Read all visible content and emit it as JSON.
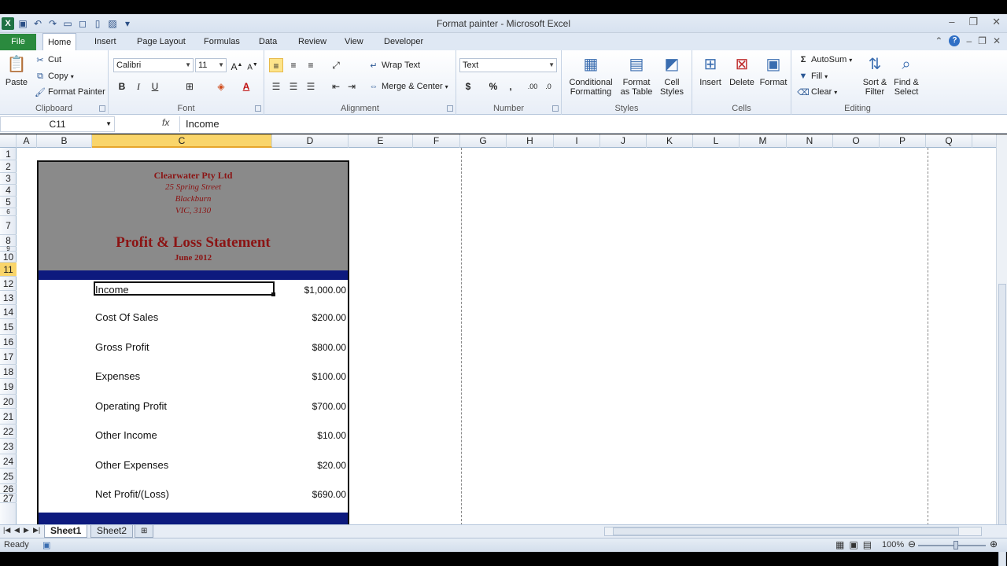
{
  "window": {
    "title": "Format painter  -  Microsoft Excel"
  },
  "tabs": {
    "file": "File",
    "items": [
      "Home",
      "Insert",
      "Page Layout",
      "Formulas",
      "Data",
      "Review",
      "View",
      "Developer"
    ]
  },
  "ribbon": {
    "clipboard": {
      "paste": "Paste",
      "cut": "Cut",
      "copy": "Copy",
      "format_painter": "Format Painter",
      "label": "Clipboard"
    },
    "font": {
      "name": "Calibri",
      "size": "11",
      "label": "Font"
    },
    "alignment": {
      "wrap": "Wrap Text",
      "merge": "Merge & Center",
      "label": "Alignment"
    },
    "number": {
      "format": "Text",
      "label": "Number"
    },
    "styles": {
      "conditional": "Conditional",
      "conditional2": "Formatting",
      "format_table": "Format",
      "format_table2": "as Table",
      "cell_styles": "Cell",
      "cell_styles2": "Styles",
      "label": "Styles"
    },
    "cells": {
      "insert": "Insert",
      "delete": "Delete",
      "format": "Format",
      "label": "Cells"
    },
    "editing": {
      "autosum": "AutoSum",
      "fill": "Fill",
      "clear": "Clear",
      "sort": "Sort &",
      "sort2": "Filter",
      "find": "Find &",
      "find2": "Select",
      "label": "Editing"
    }
  },
  "formula_bar": {
    "name_box": "C11",
    "fx": "fx",
    "content": "Income"
  },
  "columns": [
    "A",
    "B",
    "C",
    "D",
    "E",
    "F",
    "G",
    "H",
    "I",
    "J",
    "K",
    "L",
    "M",
    "N",
    "O",
    "P",
    "Q"
  ],
  "rows": [
    "1",
    "2",
    "3",
    "4",
    "5",
    "6",
    "7",
    "8",
    "9",
    "10",
    "11",
    "12",
    "13",
    "14",
    "15",
    "16",
    "17",
    "18",
    "19",
    "20",
    "21",
    "22",
    "23",
    "24",
    "25",
    "26",
    "27"
  ],
  "statement": {
    "company": "Clearwater Pty Ltd",
    "street": "25 Spring Street",
    "suburb": "Blackburn",
    "state": "VIC, 3130",
    "title": "Profit & Loss Statement",
    "period": "June 2012",
    "lines": [
      {
        "label": "Income",
        "amount": "$1,000.00"
      },
      {
        "label": "Cost Of Sales",
        "amount": "$200.00"
      },
      {
        "label": "Gross Profit",
        "amount": "$800.00"
      },
      {
        "label": "Expenses",
        "amount": "$100.00"
      },
      {
        "label": "Operating Profit",
        "amount": "$700.00"
      },
      {
        "label": "Other Income",
        "amount": "$10.00"
      },
      {
        "label": "Other Expenses",
        "amount": "$20.00"
      },
      {
        "label": "Net Profit/(Loss)",
        "amount": "$690.00"
      }
    ]
  },
  "sheets": [
    "Sheet1",
    "Sheet2"
  ],
  "status": {
    "ready": "Ready",
    "zoom": "100%"
  },
  "colors": {
    "header_gray": "#8a8a8a",
    "title_red": "#8b1414",
    "band_blue": "#0d1a7e",
    "active_header": "#f9d56b"
  }
}
